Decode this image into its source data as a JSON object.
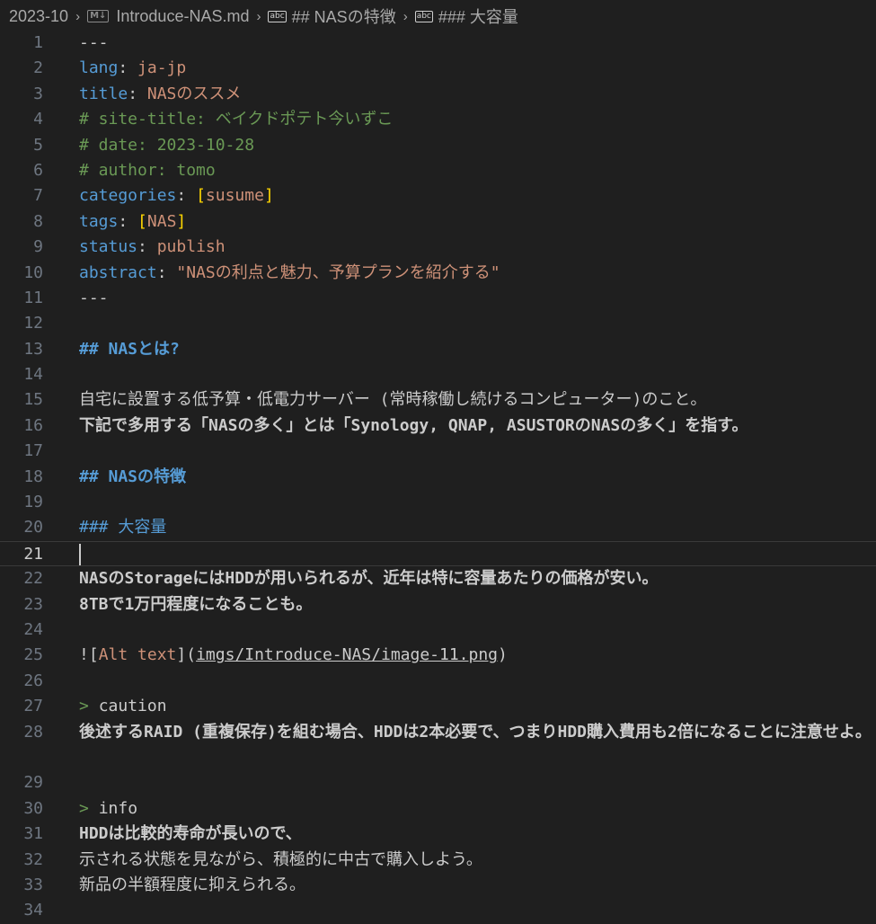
{
  "breadcrumb": {
    "folder": "2023-10",
    "file": "Introduce-NAS.md",
    "section1": "## NASの特徴",
    "section2": "### 大容量"
  },
  "icons": {
    "markdown": "M↓",
    "symbol": "abc",
    "separator": "›"
  },
  "lines": [
    {
      "n": "1",
      "code": "---"
    },
    {
      "n": "2",
      "k": "lang",
      "v": "ja-jp"
    },
    {
      "n": "3",
      "k": "title",
      "v": "NASのススメ"
    },
    {
      "n": "4",
      "comment": "# site-title: ベイクドポテト今いずこ"
    },
    {
      "n": "5",
      "comment": "# date: 2023-10-28"
    },
    {
      "n": "6",
      "comment": "# author: tomo"
    },
    {
      "n": "7",
      "k": "categories",
      "v": "susume"
    },
    {
      "n": "8",
      "k": "tags",
      "v": "NAS"
    },
    {
      "n": "9",
      "k": "status",
      "v": "publish"
    },
    {
      "n": "10",
      "k": "abstract",
      "v": "\"NASの利点と魅力、予算プランを紹介する\""
    },
    {
      "n": "11",
      "code": "---"
    },
    {
      "n": "12",
      "code": ""
    },
    {
      "n": "13",
      "heading": "## NASとは?"
    },
    {
      "n": "14",
      "code": ""
    },
    {
      "n": "15",
      "code": "自宅に設置する低予算・低電力サーバー (常時稼働し続けるコンピューター)のこと。"
    },
    {
      "n": "16",
      "code": "下記で多用する「NASの多く」とは「Synology, QNAP, ASUSTORのNASの多く」を指す。"
    },
    {
      "n": "17",
      "code": ""
    },
    {
      "n": "18",
      "heading": "## NASの特徴"
    },
    {
      "n": "19",
      "code": ""
    },
    {
      "n": "20",
      "heading": "### 大容量"
    },
    {
      "n": "21",
      "code": ""
    },
    {
      "n": "22",
      "code": "NASのStorageにはHDDが用いられるが、近年は特に容量あたりの価格が安い。"
    },
    {
      "n": "23",
      "code": "8TBで1万円程度になることも。"
    },
    {
      "n": "24",
      "code": ""
    },
    {
      "n": "25",
      "image_alt": "Alt text",
      "image_path": "imgs/Introduce-NAS/image-11.png"
    },
    {
      "n": "26",
      "code": ""
    },
    {
      "n": "27",
      "quote": "caution"
    },
    {
      "n": "28",
      "code": "後述するRAID (重複保存)を組む場合、HDDは2本必要で、つまりHDD購入費用も2倍になることに注意せよ。"
    },
    {
      "n": "29",
      "code": ""
    },
    {
      "n": "30",
      "quote": "info"
    },
    {
      "n": "31",
      "code": "HDDは比較的寿命が長いので、"
    },
    {
      "n": "32",
      "code": "示される状態を見ながら、積極的に中古で購入しよう。"
    },
    {
      "n": "33",
      "code": "新品の半額程度に抑えられる。"
    },
    {
      "n": "34",
      "code": ""
    }
  ]
}
